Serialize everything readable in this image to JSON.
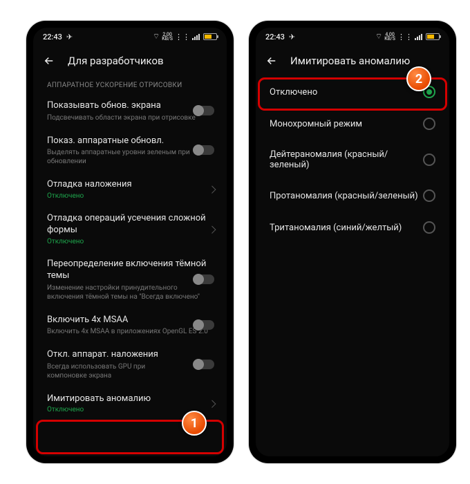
{
  "status": {
    "time": "22:43",
    "speed_value": "2,00",
    "speed_unit": "KB/S",
    "rate": "4,00"
  },
  "left_screen": {
    "title": "Для разработчиков",
    "section": "АППАРАТНОЕ УСКОРЕНИЕ ОТРИСОВКИ",
    "items": {
      "show_updates": {
        "title": "Показывать обнов. экрана",
        "sub": "Подсвечивать области экрана при отрисовке"
      },
      "hw_updates": {
        "title": "Показ. аппаратные обновл.",
        "sub": "Выделять аппаратные уровни зеленым при обновлении"
      },
      "overlay_debug": {
        "title": "Отладка наложения",
        "status": "Отключено"
      },
      "clip_debug": {
        "title": "Отладка операций усечения сложной формы",
        "status": "Отключено"
      },
      "dark_override": {
        "title": "Переопределение включения тёмной темы",
        "sub": "Изменение настройки принудительного включения тёмной темы на \"Всегда включено\""
      },
      "msaa": {
        "title": "Включить 4x MSAA",
        "sub": "Включить 4x MSAA в приложениях OpenGL ES 2.0"
      },
      "hw_overlays": {
        "title": "Откл. аппарат. наложения",
        "sub": "Всегда использовать GPU при компоновке экрана"
      },
      "simulate": {
        "title": "Имитировать аномалию",
        "status": "Отключено"
      }
    }
  },
  "right_screen": {
    "title": "Имитировать аномалию",
    "options": {
      "off": "Отключено",
      "mono": "Монохромный режим",
      "deuter": "Дейтераномалия (красный/зеленый)",
      "protan": "Протаномалия (красный/зеленый)",
      "tritan": "Тританомалия (синий/желтый)"
    }
  },
  "markers": {
    "one": "1",
    "two": "2"
  }
}
